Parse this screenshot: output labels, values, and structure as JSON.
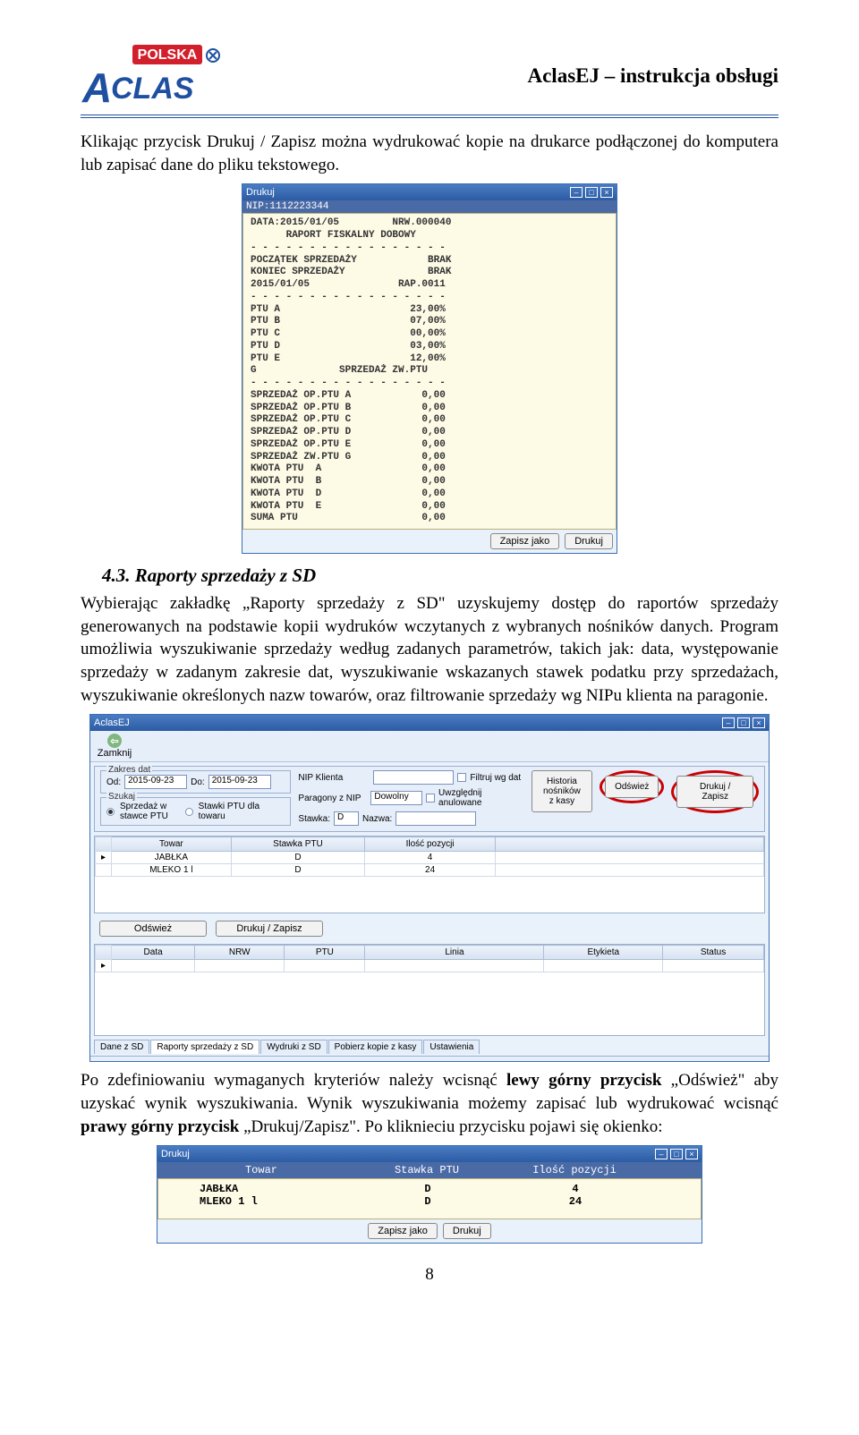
{
  "header": {
    "logo_top": "POLSKA",
    "logo_main": "ACLAS",
    "doc_title": "AclasEJ – instrukcja obsługi"
  },
  "para1": "Klikając przycisk Drukuj / Zapisz można wydrukować kopie na drukarce podłączonej do komputera lub zapisać dane do pliku tekstowego.",
  "report_win": {
    "title": "Drukuj",
    "nip_header": "NIP:1112223344",
    "text": "DATA:2015/01/05         NRW.000040\n      RAPORT FISKALNY DOBOWY\n- - - - - - - - - - - - - - - - -\nPOCZĄTEK SPRZEDAŻY            BRAK\nKONIEC SPRZEDAŻY              BRAK\n2015/01/05               RAP.0011\n- - - - - - - - - - - - - - - - -\nPTU A                      23,00%\nPTU B                      07,00%\nPTU C                      00,00%\nPTU D                      03,00%\nPTU E                      12,00%\nG              SPRZEDAŻ ZW.PTU\n- - - - - - - - - - - - - - - - -\nSPRZEDAŻ OP.PTU A            0,00\nSPRZEDAŻ OP.PTU B            0,00\nSPRZEDAŻ OP.PTU C            0,00\nSPRZEDAŻ OP.PTU D            0,00\nSPRZEDAŻ OP.PTU E            0,00\nSPRZEDAŻ ZW.PTU G            0,00\nKWOTA PTU  A                 0,00\nKWOTA PTU  B                 0,00\nKWOTA PTU  D                 0,00\nKWOTA PTU  E                 0,00\nSUMA PTU                     0,00",
    "btn_save": "Zapisz jako",
    "btn_print": "Drukuj"
  },
  "section": {
    "num": "4.3.",
    "title": "Raporty sprzedaży z SD"
  },
  "para2a": "Wybierając zakładkę „Raporty sprzedaży z SD\" uzyskujemy dostęp do raportów sprzedaży generowanych na podstawie kopii wydruków wczytanych z wybranych nośników danych. Program umożliwia wyszukiwanie sprzedaży według zadanych parametrów, takich jak: data, występowanie sprzedaży w zadanym zakresie dat, wyszukiwanie wskazanych stawek podatku przy sprzedażach, wyszukiwanie określonych nazw towarów, oraz filtrowanie sprzedaży wg NIPu klienta na paragonie.",
  "app": {
    "title": "AclasEJ",
    "close_label": "Zamknij",
    "dates_legend": "Zakres dat",
    "od_label": "Od:",
    "od_value": "2015-09-23",
    "do_label": "Do:",
    "do_value": "2015-09-23",
    "szukaj_legend": "Szukaj",
    "radio1": "Sprzedaż w stawce PTU",
    "radio2": "Stawki PTU dla towaru",
    "nip_label": "NIP Klienta",
    "paragony_label": "Paragony z NIP",
    "paragony_value": "Dowolny",
    "stawka_label": "Stawka:",
    "stawka_value": "D",
    "nazwa_label": "Nazwa:",
    "filtr_dat": "Filtruj wg dat",
    "uwzgl": "Uwzględnij anulowane",
    "historia_btn": "Historia nośników z kasy",
    "odswiez_btn": "Odśwież",
    "drukuj_btn": "Drukuj / Zapisz",
    "table1": {
      "headers": [
        "Towar",
        "Stawka PTU",
        "Ilość pozycji"
      ],
      "rows": [
        [
          "JABŁKA",
          "D",
          "4"
        ],
        [
          "MLEKO 1 l",
          "D",
          "24"
        ]
      ]
    },
    "btn_refresh2": "Odśwież",
    "btn_print2": "Drukuj / Zapisz",
    "table2": {
      "headers": [
        "Data",
        "NRW",
        "PTU",
        "Linia",
        "Etykieta",
        "Status"
      ]
    },
    "tabs": [
      "Dane z SD",
      "Raporty sprzedaży z SD",
      "Wydruki z SD",
      "Pobierz kopie z kasy",
      "Ustawienia"
    ]
  },
  "para3": "Po zdefiniowaniu wymaganych kryteriów należy wcisnąć ",
  "para3b": "lewy górny przycisk",
  "para3c": " „Odśwież\" aby uzyskać wynik wyszukiwania. Wynik wyszukiwania możemy zapisać lub wydrukować wcisnąć ",
  "para3d": "prawy górny przycisk",
  "para3e": " „Drukuj/Zapisz\". Po kliknieciu przycisku pojawi się okienko:",
  "print_win": {
    "title": "Drukuj",
    "headers": [
      "Towar",
      "Stawka PTU",
      "Ilość pozycji"
    ],
    "rows": [
      [
        "JABŁKA",
        "D",
        "4"
      ],
      [
        "MLEKO 1 l",
        "D",
        "24"
      ]
    ],
    "btn_save": "Zapisz jako",
    "btn_print": "Drukuj"
  },
  "page_num": "8"
}
